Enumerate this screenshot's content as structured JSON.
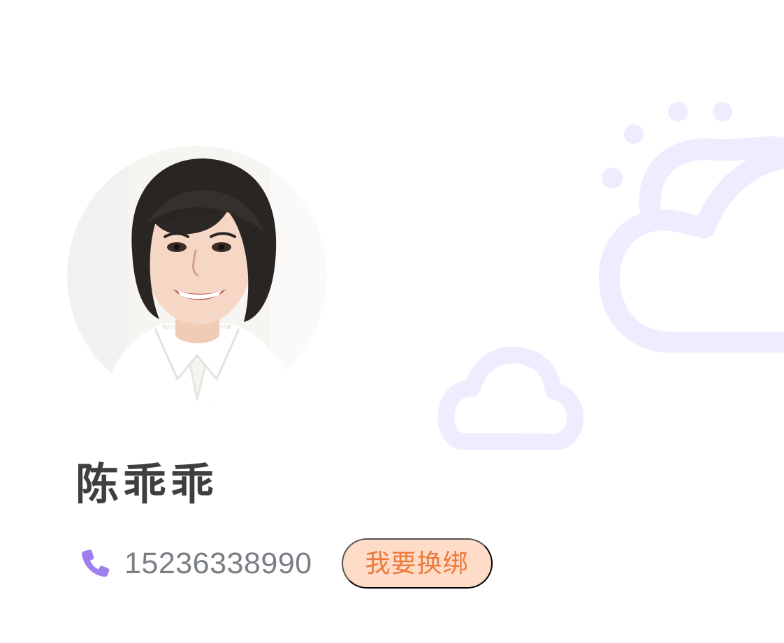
{
  "profile": {
    "name": "陈乖乖",
    "phone": "15236338990",
    "rebind_label": "我要换绑"
  },
  "icons": {
    "avatar": "profile-photo",
    "phone": "phone-icon",
    "decorations": [
      "sun-cloud-icon",
      "cloud-icon"
    ]
  },
  "colors": {
    "name_text": "#3f3f3f",
    "phone_text": "#7a7f85",
    "phone_icon": "#9f7ff0",
    "rebind_bg": "#ffdcc8",
    "rebind_text": "#eb7a3b",
    "decoration": "#f0ebff"
  }
}
